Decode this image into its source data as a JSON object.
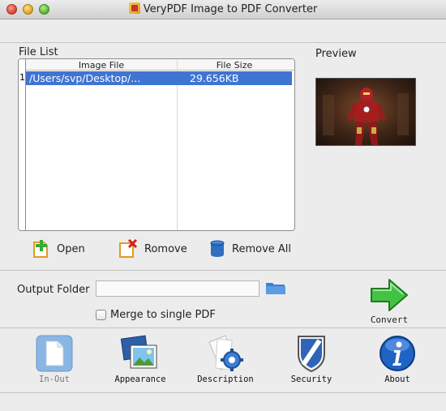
{
  "window": {
    "title": "VeryPDF Image to PDF Converter"
  },
  "file_list": {
    "label": "File List",
    "columns": [
      "Image File",
      "File Size"
    ],
    "rows": [
      {
        "index": "1",
        "file": "/Users/svp/Desktop/...",
        "size": "29.656KB",
        "selected": true
      }
    ]
  },
  "preview": {
    "label": "Preview"
  },
  "actions": {
    "open": "Open",
    "remove": "Romove",
    "remove_all": "Remove All"
  },
  "output": {
    "label": "Output Folder",
    "value": "",
    "merge_label": "Merge to single PDF",
    "merge_checked": false
  },
  "convert": {
    "label": "Convert"
  },
  "toolbar": {
    "in_out": "In-Out",
    "appearance": "Appearance",
    "description": "Description",
    "security": "Security",
    "about": "About"
  },
  "colors": {
    "selection": "#3f74d2",
    "convert_green": "#3bb33b",
    "about_blue": "#1f63c4"
  }
}
